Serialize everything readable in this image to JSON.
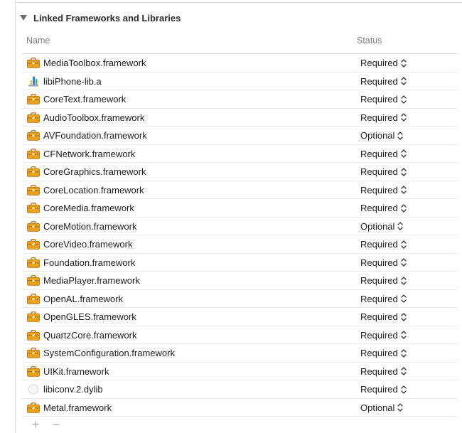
{
  "section": {
    "title": "Linked Frameworks and Libraries"
  },
  "columns": {
    "name": "Name",
    "status": "Status"
  },
  "rows": [
    {
      "name": "MediaToolbox.framework",
      "status": "Required",
      "icon": "framework-toolbox-icon"
    },
    {
      "name": "libiPhone-lib.a",
      "status": "Required",
      "icon": "static-library-icon"
    },
    {
      "name": "CoreText.framework",
      "status": "Required",
      "icon": "framework-toolbox-icon"
    },
    {
      "name": "AudioToolbox.framework",
      "status": "Required",
      "icon": "framework-toolbox-icon"
    },
    {
      "name": "AVFoundation.framework",
      "status": "Optional",
      "icon": "framework-toolbox-icon"
    },
    {
      "name": "CFNetwork.framework",
      "status": "Required",
      "icon": "framework-toolbox-icon"
    },
    {
      "name": "CoreGraphics.framework",
      "status": "Required",
      "icon": "framework-toolbox-icon"
    },
    {
      "name": "CoreLocation.framework",
      "status": "Required",
      "icon": "framework-toolbox-icon"
    },
    {
      "name": "CoreMedia.framework",
      "status": "Required",
      "icon": "framework-toolbox-icon"
    },
    {
      "name": "CoreMotion.framework",
      "status": "Optional",
      "icon": "framework-toolbox-icon"
    },
    {
      "name": "CoreVideo.framework",
      "status": "Required",
      "icon": "framework-toolbox-icon"
    },
    {
      "name": "Foundation.framework",
      "status": "Required",
      "icon": "framework-toolbox-icon"
    },
    {
      "name": "MediaPlayer.framework",
      "status": "Required",
      "icon": "framework-toolbox-icon"
    },
    {
      "name": "OpenAL.framework",
      "status": "Required",
      "icon": "framework-toolbox-icon"
    },
    {
      "name": "OpenGLES.framework",
      "status": "Required",
      "icon": "framework-toolbox-icon"
    },
    {
      "name": "QuartzCore.framework",
      "status": "Required",
      "icon": "framework-toolbox-icon"
    },
    {
      "name": "SystemConfiguration.framework",
      "status": "Required",
      "icon": "framework-toolbox-icon"
    },
    {
      "name": "UIKit.framework",
      "status": "Required",
      "icon": "framework-toolbox-icon"
    },
    {
      "name": "libiconv.2.dylib",
      "status": "Required",
      "icon": "dylib-icon"
    },
    {
      "name": "Metal.framework",
      "status": "Optional",
      "icon": "framework-toolbox-icon"
    }
  ],
  "toolbar": {
    "add_label": "+",
    "remove_label": "−"
  },
  "colors": {
    "toolbox": "#e8a21f",
    "toolbox_dark": "#b87412",
    "library": "#3b7fd9"
  }
}
